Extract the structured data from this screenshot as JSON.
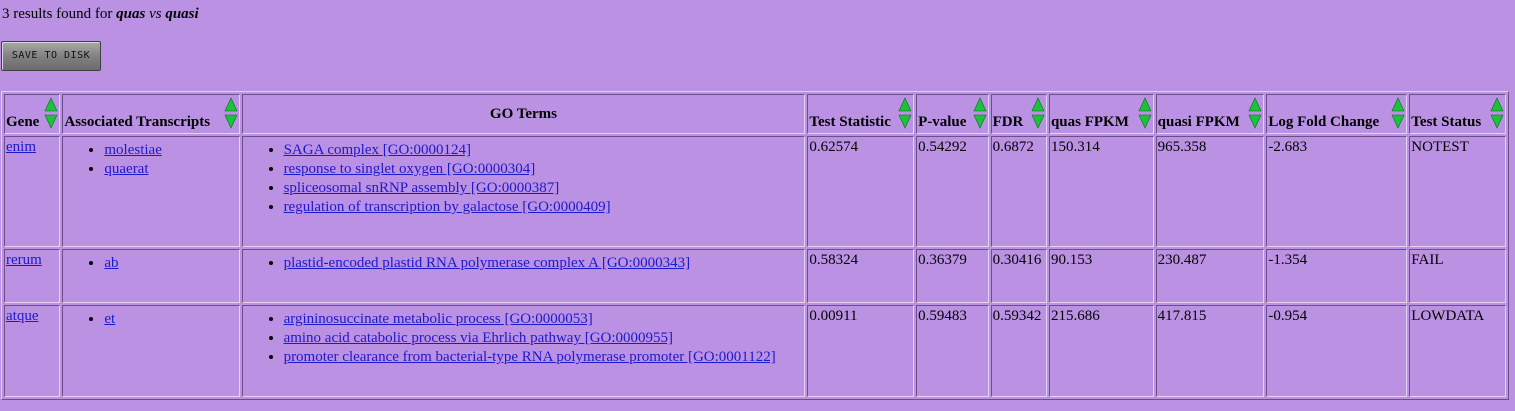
{
  "summary": {
    "prefix": "3 results found for",
    "sample1": "quas",
    "vs": "vs",
    "sample2": "quasi"
  },
  "save_button_label": "SAVE TO DISK",
  "columns": [
    {
      "label": "Gene",
      "sortable": true
    },
    {
      "label": "Associated Transcripts",
      "sortable": true
    },
    {
      "label": "GO Terms",
      "sortable": false
    },
    {
      "label": "Test Statistic",
      "sortable": true
    },
    {
      "label": "P-value",
      "sortable": true
    },
    {
      "label": "FDR",
      "sortable": true
    },
    {
      "label": "quas FPKM",
      "sortable": true
    },
    {
      "label": "quasi FPKM",
      "sortable": true
    },
    {
      "label": "Log Fold Change",
      "sortable": true
    },
    {
      "label": "Test Status",
      "sortable": true
    }
  ],
  "rows": [
    {
      "gene": "enim",
      "transcripts": [
        "molestiae",
        "quaerat"
      ],
      "go_terms": [
        "SAGA complex [GO:0000124]",
        "response to singlet oxygen [GO:0000304]",
        "spliceosomal snRNP assembly [GO:0000387]",
        "regulation of transcription by galactose [GO:0000409]"
      ],
      "test_statistic": "0.62574",
      "p_value": "0.54292",
      "fdr": "0.6872",
      "quas_fpkm": "150.314",
      "quasi_fpkm": "965.358",
      "log_fold_change": "-2.683",
      "test_status": "NOTEST"
    },
    {
      "gene": "rerum",
      "transcripts": [
        "ab"
      ],
      "go_terms": [
        "plastid-encoded plastid RNA polymerase complex A [GO:0000343]"
      ],
      "test_statistic": "0.58324",
      "p_value": "0.36379",
      "fdr": "0.30416",
      "quas_fpkm": "90.153",
      "quasi_fpkm": "230.487",
      "log_fold_change": "-1.354",
      "test_status": "FAIL"
    },
    {
      "gene": "atque",
      "transcripts": [
        "et"
      ],
      "go_terms": [
        "argininosuccinate metabolic process [GO:0000053]",
        "amino acid catabolic process via Ehrlich pathway [GO:0000955]",
        "promoter clearance from bacterial-type RNA polymerase promoter [GO:0001122]"
      ],
      "test_statistic": "0.00911",
      "p_value": "0.59483",
      "fdr": "0.59342",
      "quas_fpkm": "215.686",
      "quasi_fpkm": "417.815",
      "log_fold_change": "-0.954",
      "test_status": "LOWDATA"
    }
  ],
  "colors": {
    "background": "#bb92e3",
    "link": "#1d19cc",
    "sort_arrow": "#19c43a"
  },
  "icons": {
    "sort": "sort-up-down-arrows-icon"
  }
}
